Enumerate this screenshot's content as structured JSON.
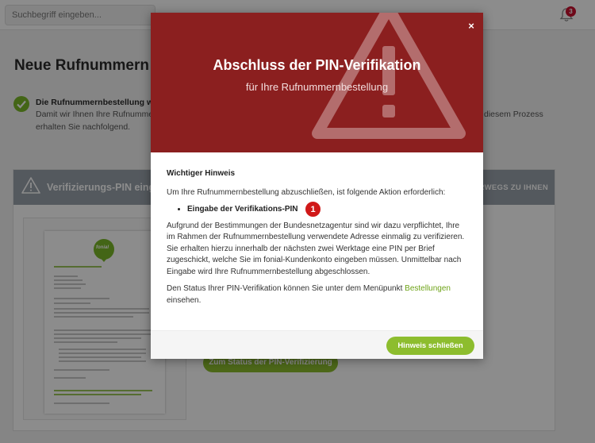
{
  "header": {
    "search_placeholder": "Suchbegriff eingeben...",
    "notification_count": "3"
  },
  "page": {
    "title": "Neue Rufnummern be",
    "info_bold": "Die Rufnummernbestellung wur",
    "info_line1": "Damit wir Ihnen Ihre Rufnummer",
    "info_line1_right": "diesem Prozess",
    "info_line2": "erhalten Sie nachfolgend.",
    "card_title": "Verifizierungs-PIN einge",
    "card_header_right": "ERWEGS ZU IHNEN",
    "card_button": "Zum Status der PIN-Verifizierung",
    "doc_logo_text": "fonial"
  },
  "modal": {
    "title": "Abschluss der PIN-Verifikation",
    "subtitle": "für Ihre Rufnummernbestellung",
    "close_label": "×",
    "heading": "Wichtiger Hinweis",
    "intro": "Um Ihre Rufnummernbestellung abzuschließen, ist folgende Aktion erforderlich:",
    "action_item": "Eingabe der Verifikations-PIN",
    "step_badge": "1",
    "body_paragraph": "Aufgrund der Bestimmungen der Bundesnetzagentur sind wir dazu verpflichtet, Ihre im Rahmen der Rufnummernbestellung verwendete Adresse einmalig zu verifizieren. Sie erhalten hierzu innerhalb der nächsten zwei Werktage eine PIN per Brief zugeschickt, welche Sie im fonial-Kundenkonto eingeben müssen. Unmittelbar nach Eingabe wird Ihre Rufnummernbestellung abgeschlossen.",
    "status_text_before": "Den Status Ihrer PIN-Verifikation können Sie unter dem Menüpunkt ",
    "status_link": "Bestellungen",
    "status_text_after": " einsehen.",
    "close_button": "Hinweis schließen"
  },
  "colors": {
    "modal_header": "#8b1f1f",
    "accent_green": "#8dbd2e",
    "badge_red": "#d01818"
  }
}
